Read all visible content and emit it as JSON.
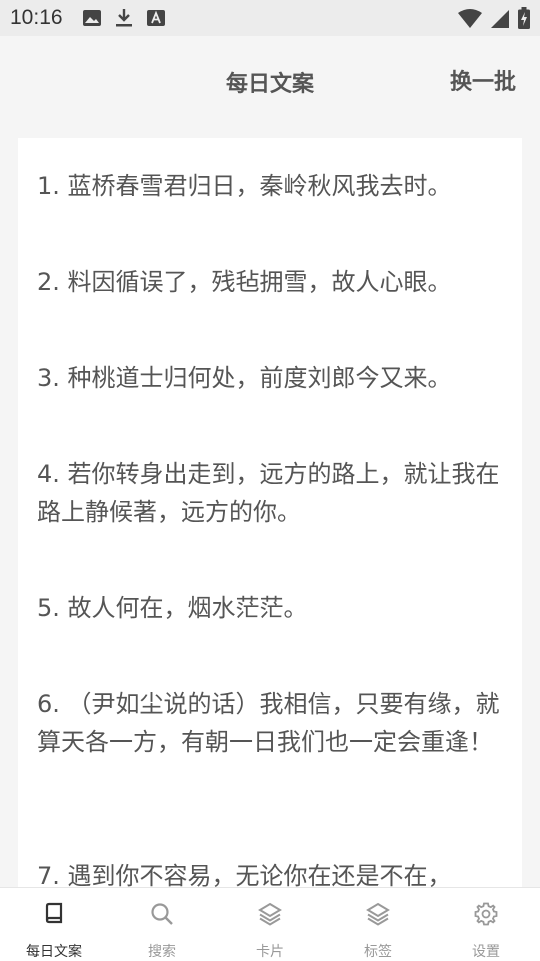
{
  "status_bar": {
    "time": "10:16",
    "left_icons": [
      "image-icon",
      "download-icon",
      "text-badge-icon"
    ],
    "right_icons": [
      "wifi-icon",
      "signal-icon",
      "battery-icon"
    ]
  },
  "header": {
    "title": "每日文案",
    "refresh_label": "换一批"
  },
  "quotes": [
    {
      "text": "1. 蓝桥春雪君归日，秦岭秋风我去时。"
    },
    {
      "text": "2. 料因循误了，残毡拥雪，故人心眼。"
    },
    {
      "text": "3. 种桃道士归何处，前度刘郎今又来。"
    },
    {
      "text": "4. 若你转身出走到，远方的路上，就让我在路上静候著，远方的你。"
    },
    {
      "text": "5. 故人何在，烟水茫茫。"
    },
    {
      "text": "6. （尹如尘说的话）我相信，只要有缘，就算天各一方，有朝一日我们也一定会重逢！"
    },
    {
      "text": "7. 遇到你不容易，无论你在还是不在，"
    }
  ],
  "bottom_nav": {
    "items": [
      {
        "label": "每日文案",
        "icon": "book-icon",
        "active": true
      },
      {
        "label": "搜索",
        "icon": "search-icon",
        "active": false
      },
      {
        "label": "卡片",
        "icon": "layers-icon",
        "active": false
      },
      {
        "label": "标签",
        "icon": "layers-icon",
        "active": false
      },
      {
        "label": "设置",
        "icon": "gear-icon",
        "active": false
      }
    ]
  },
  "colors": {
    "background": "#f5f5f5",
    "card": "#ffffff",
    "text": "#555555",
    "nav_active": "#333333",
    "nav_inactive": "#999999"
  }
}
